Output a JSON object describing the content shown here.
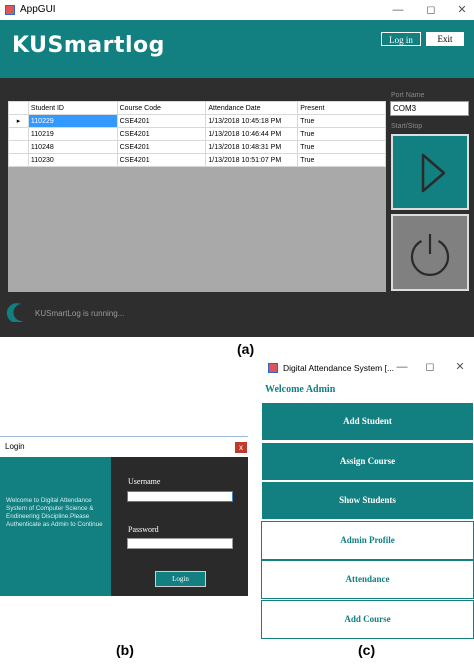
{
  "panel_a": {
    "title": "AppGUI",
    "brand": "KUSmartlog",
    "login_button": "Log in",
    "exit_button": "Exit",
    "columns": [
      "Student ID",
      "Course Code",
      "Attendance Date",
      "Present"
    ],
    "rows": [
      [
        "110229",
        "CSE4201",
        "1/13/2018 10:45:18 PM",
        "True"
      ],
      [
        "110219",
        "CSE4201",
        "1/13/2018 10:46:44 PM",
        "True"
      ],
      [
        "110248",
        "CSE4201",
        "1/13/2018 10:48:31 PM",
        "True"
      ],
      [
        "110230",
        "CSE4201",
        "1/13/2018 10:51:07 PM",
        "True"
      ]
    ],
    "port_label": "Port Name",
    "port_value": "COM3",
    "start_stop_label": "Start/Stop",
    "status": "KUSmartLog is running...",
    "caption": "(a)"
  },
  "panel_b": {
    "title": "Login",
    "close": "x",
    "welcome": "Welcome to Digital Attendance System of Computer Science & Endineering Discipline.Please Authenticate as Admin to Continue",
    "username_label": "Username",
    "password_label": "Password",
    "login_button": "Login",
    "caption": "(b)"
  },
  "panel_c": {
    "title": "Digital Attendance System [...",
    "welcome": "Welcome Admin",
    "menu": [
      {
        "label": "Add Student",
        "style": "dark"
      },
      {
        "label": "Assign Course",
        "style": "dark"
      },
      {
        "label": "Show Students",
        "style": "dark"
      },
      {
        "label": "Admin Profile",
        "style": "light"
      },
      {
        "label": "Attendance",
        "style": "light"
      },
      {
        "label": "Add Course",
        "style": "light"
      }
    ],
    "caption": "(c)"
  },
  "colors": {
    "accent": "#127f80",
    "dark_bg": "#2e2e2e",
    "selection": "#3399ff"
  },
  "icons": [
    "play-icon",
    "power-icon",
    "spinner-icon",
    "minimize-icon",
    "maximize-icon",
    "close-icon"
  ]
}
